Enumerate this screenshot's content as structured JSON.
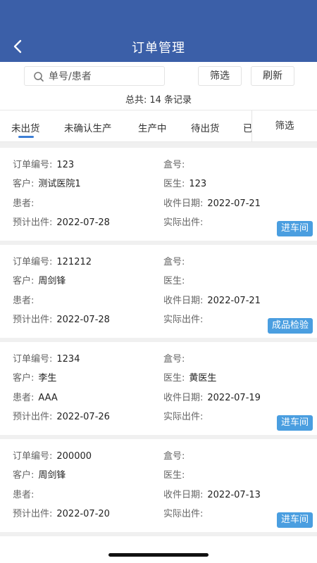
{
  "header": {
    "title": "订单管理"
  },
  "search": {
    "placeholder": "单号/患者",
    "value": ""
  },
  "toolbar": {
    "filter_label": "筛选",
    "refresh_label": "刷新"
  },
  "summary": {
    "prefix": "总共:",
    "count": "14",
    "suffix": "条记录"
  },
  "tabs": [
    {
      "label": "未出货",
      "active": true
    },
    {
      "label": "未确认生产",
      "active": false
    },
    {
      "label": "生产中",
      "active": false
    },
    {
      "label": "待出货",
      "active": false
    },
    {
      "label": "已",
      "active": false
    }
  ],
  "tab_filter": {
    "label": "筛选"
  },
  "field_labels": {
    "order_no": "订单编号:",
    "box_no": "盒号:",
    "customer": "客户:",
    "doctor": "医生:",
    "patient": "患者:",
    "receive_date": "收件日期:",
    "planned_ship": "预计出件:",
    "actual_ship": "实际出件:"
  },
  "orders": [
    {
      "order_no": "123",
      "box_no": "",
      "customer": "测试医院1",
      "doctor": "123",
      "patient": "",
      "receive_date": "2022-07-21",
      "planned_ship": "2022-07-28",
      "actual_ship": "",
      "status": "进车间"
    },
    {
      "order_no": "121212",
      "box_no": "",
      "customer": "周剑锋",
      "doctor": "",
      "patient": "",
      "receive_date": "2022-07-21",
      "planned_ship": "2022-07-28",
      "actual_ship": "",
      "status": "成品检验"
    },
    {
      "order_no": "1234",
      "box_no": "",
      "customer": "李生",
      "doctor": "黄医生",
      "patient": "AAA",
      "receive_date": "2022-07-19",
      "planned_ship": "2022-07-26",
      "actual_ship": "",
      "status": "进车间"
    },
    {
      "order_no": "200000",
      "box_no": "",
      "customer": "周剑锋",
      "doctor": "",
      "patient": "",
      "receive_date": "2022-07-13",
      "planned_ship": "2022-07-20",
      "actual_ship": "",
      "status": "进车间"
    }
  ],
  "colors": {
    "header_bg": "#3b5fa8",
    "accent": "#3e7fd6",
    "badge_bg": "#4a9ee0",
    "list_bg": "#f0f0f0"
  }
}
